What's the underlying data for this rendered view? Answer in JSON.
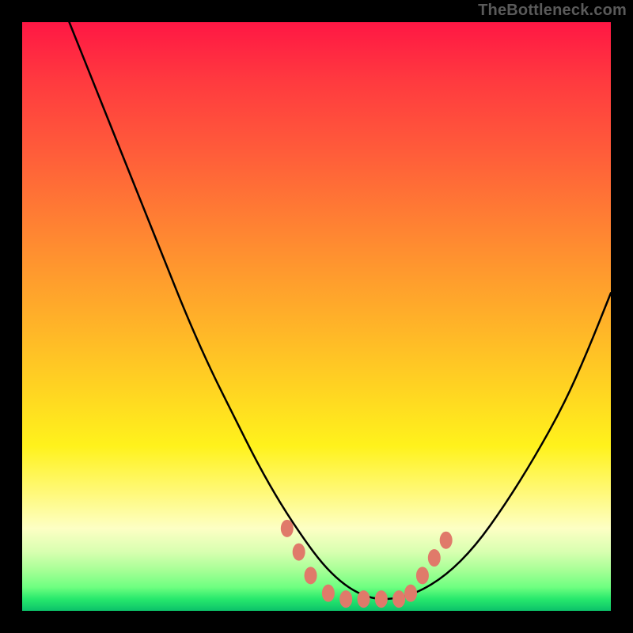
{
  "watermark": "TheBottleneck.com",
  "chart_data": {
    "type": "line",
    "title": "",
    "xlabel": "",
    "ylabel": "",
    "xlim": [
      0,
      100
    ],
    "ylim": [
      0,
      100
    ],
    "grid": false,
    "legend": false,
    "series": [
      {
        "name": "curve",
        "color": "#000000",
        "x": [
          8,
          12,
          16,
          20,
          24,
          28,
          32,
          36,
          40,
          44,
          48,
          51,
          54,
          57,
          60,
          63,
          67,
          72,
          77,
          82,
          87,
          92,
          96,
          100
        ],
        "y": [
          100,
          90,
          80,
          70,
          60,
          50,
          41,
          33,
          25,
          18,
          12,
          8,
          5,
          3,
          2,
          2,
          3,
          6,
          11,
          18,
          26,
          35,
          44,
          54
        ]
      }
    ],
    "markers": {
      "name": "bottom-cluster",
      "color": "#e07a6a",
      "points": [
        {
          "x": 45,
          "y": 14
        },
        {
          "x": 47,
          "y": 10
        },
        {
          "x": 49,
          "y": 6
        },
        {
          "x": 52,
          "y": 3
        },
        {
          "x": 55,
          "y": 2
        },
        {
          "x": 58,
          "y": 2
        },
        {
          "x": 61,
          "y": 2
        },
        {
          "x": 64,
          "y": 2
        },
        {
          "x": 66,
          "y": 3
        },
        {
          "x": 68,
          "y": 6
        },
        {
          "x": 70,
          "y": 9
        },
        {
          "x": 72,
          "y": 12
        }
      ]
    },
    "background_gradient": {
      "top": "#ff1744",
      "middle": "#ffd322",
      "bottom": "#0cc26a"
    }
  }
}
